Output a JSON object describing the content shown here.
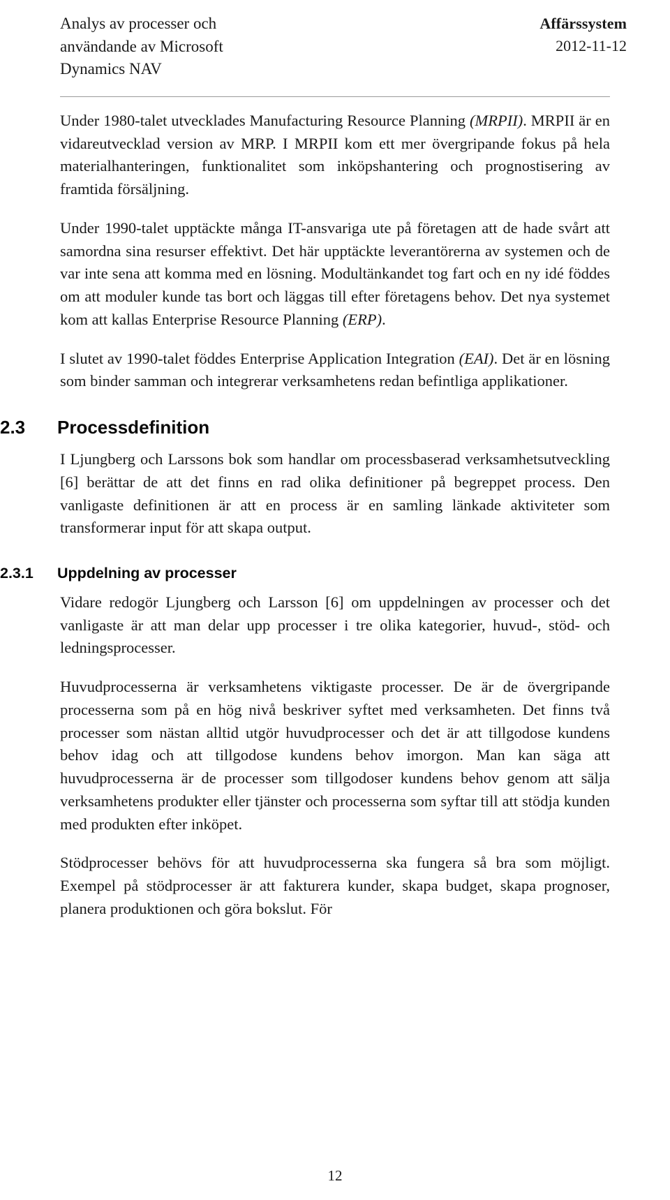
{
  "header": {
    "title_lines": [
      "Analys av processer och",
      "användande av Microsoft",
      "Dynamics NAV"
    ],
    "subject": "Affärssystem",
    "date": "2012-11-12"
  },
  "body": {
    "p1_a": "Under 1980-talet utvecklades Manufacturing Resource Planning ",
    "p1_b": "(MRPII)",
    "p1_c": ". MRPII är en vidareutvecklad version av MRP. I MRPII kom ett mer övergripande fokus på hela materialhanteringen, funktionalitet som inköpshantering och prognostisering av framtida försäljning.",
    "p2_a": "Under 1990-talet upptäckte många IT-ansvariga ute på företagen att de hade svårt att samordna sina resurser effektivt. Det här upptäckte leverantörerna av systemen och de var inte sena att komma med en lösning. Modultänkandet tog fart och en ny idé föddes om att moduler kunde tas bort och läggas till efter företagens behov. Det nya systemet kom att kallas Enterprise Resource Planning ",
    "p2_b": "(ERP)",
    "p2_c": ".",
    "p3_a": "I slutet av 1990-talet föddes Enterprise Application Integration ",
    "p3_b": "(EAI)",
    "p3_c": ". Det är en lösning som binder samman och integrerar verksamhetens redan befintliga applikationer."
  },
  "section_2_3": {
    "number": "2.3",
    "title": "Processdefinition",
    "paragraph": "I Ljungberg och Larssons bok som handlar om processbaserad verksamhetsutveckling [6] berättar de att det finns en rad olika definitioner på begreppet process. Den vanligaste definitionen är att en process är en samling länkade aktiviteter som transformerar input för att skapa output."
  },
  "section_2_3_1": {
    "number": "2.3.1",
    "title": "Uppdelning av processer",
    "paragraph_1": "Vidare redogör Ljungberg och Larsson [6] om uppdelningen av processer och det vanligaste är att man delar upp processer i tre olika kategorier, huvud-, stöd- och ledningsprocesser.",
    "paragraph_2": "Huvudprocesserna är verksamhetens viktigaste processer. De är de övergripande processerna som på en hög nivå beskriver syftet med verksamheten. Det finns två processer som nästan alltid utgör huvudprocesser och det är att tillgodose kundens behov idag och att tillgodose kundens behov imorgon. Man kan säga att huvudprocesserna är de processer som tillgodoser kundens behov genom att sälja verksamhetens produkter eller tjänster och processerna som syftar till att stödja kunden med produkten efter inköpet.",
    "paragraph_3": "Stödprocesser behövs för att huvudprocesserna ska fungera så bra som möjligt. Exempel på stödprocesser är att fakturera kunder, skapa budget, skapa prognoser, planera produktionen och göra bokslut. För"
  },
  "footer": {
    "page_number": "12"
  }
}
